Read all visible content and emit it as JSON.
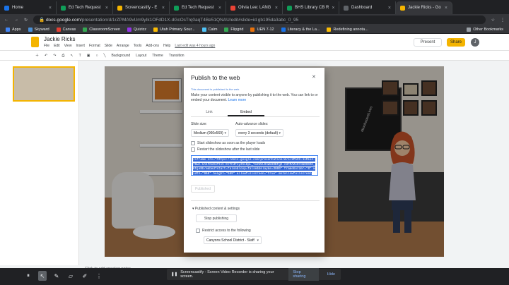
{
  "browser": {
    "tabs": [
      {
        "title": "Home",
        "color": "#1a73e8"
      },
      {
        "title": "Ed Tech Request",
        "color": "#0f9d58"
      },
      {
        "title": "Screencastify - E",
        "color": "#f4b400"
      },
      {
        "title": "Ed Tech Request",
        "color": "#0f9d58"
      },
      {
        "title": "Olivia Lee: LANG",
        "color": "#ea4335"
      },
      {
        "title": "BHS Library CB R",
        "color": "#0f9d58"
      },
      {
        "title": "Dashboard",
        "color": "#5f6368"
      },
      {
        "title": "Jackie Ricks - Go",
        "color": "#f4b400"
      }
    ],
    "url_host": "docs.google.com",
    "url_path": "/presentation/d/1rZPMA9vUm9yIk1OFdD1X-dGcOsTrq0aqT4Be51QNAU/edit#slide=id.gb195da3abc_0_95",
    "bookmarks": [
      "Apps",
      "Skyward",
      "Canvas",
      "ClassroomScreen",
      "Quizizz",
      "Utah Primary Sour...",
      "Calm",
      "Flipgrid",
      "UEN 7-12",
      "Literacy & the La...",
      "Redefining annota..."
    ],
    "other_bookmarks": "Other Bookmarks"
  },
  "slides": {
    "doc_title": "Jackie Ricks",
    "menus": [
      "File",
      "Edit",
      "View",
      "Insert",
      "Format",
      "Slide",
      "Arrange",
      "Tools",
      "Add-ons",
      "Help"
    ],
    "last_edit": "Last edit was 4 hours ago",
    "present": "Present",
    "share": "Share",
    "avatar": "J",
    "toolbar": [
      "Background",
      "Layout",
      "Theme",
      "Transition"
    ],
    "speaker_notes": "Click to add speaker notes",
    "blackboard_text": "#bookssaveLives"
  },
  "dialog": {
    "title": "Publish to the web",
    "note": "This document is published to the web.",
    "description": "Make your content visible to anyone by publishing it to the web. You can link to or embed your document.",
    "learn_more": "Learn more",
    "tab_link": "Link",
    "tab_embed": "Embed",
    "slide_size_label": "Slide size:",
    "slide_size_value": "Medium (960x569)",
    "auto_advance_label": "Auto-advance slides:",
    "auto_advance_value": "every 3 seconds (default)",
    "start_on_load": "Start slideshow as soon as the player loads",
    "restart_after_last": "Restart the slideshow after the last slide",
    "embed_code": "<iframe src=\"https://docs.google.com/presentation/d/e/2PACX-1vRLkA-70wA-kA4FOxDsPtsh-KYFh4Fsy3hLDpL_YoZmVL0nWk80BFgE-A3FMAZxD7dm90CRA_K5jeNb/embed?start=false&loop=false&delayms=3000\" frameborder=\"0\" width=\"960\" height=\"569\" allowfullscreen=\"true\" mozallowfullscreen=\"true\">",
    "published_button": "Published",
    "published_section": "Published content & settings",
    "stop_publishing": "Stop publishing",
    "restrict_access": "Restrict access to the following",
    "org_value": "Canyons School District - Staff"
  },
  "recorder": {
    "message": "Screencastify - Screen Video Recorder is sharing your screen.",
    "stop": "Stop sharing",
    "hide": "Hide"
  }
}
